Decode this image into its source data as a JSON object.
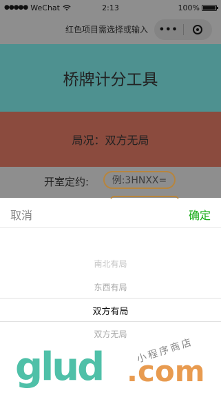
{
  "status_bar": {
    "carrier": "WeChat",
    "time": "2:13",
    "battery_percent": "100%",
    "battery_level": 1.0
  },
  "navbar": {
    "title": "红色项目需选择或输入",
    "more_glyph": "•••"
  },
  "app": {
    "title": "桥牌计分工具",
    "status": "局况：双方无局"
  },
  "contract": {
    "label": "开室定约:",
    "placeholder": "例:3HNXX="
  },
  "picker": {
    "cancel": "取消",
    "confirm": "确定",
    "options": [
      "南北有局",
      "东西有局",
      "双方有局",
      "双方无局"
    ],
    "selected": "双方有局"
  },
  "watermark": {
    "logo": "glud",
    "dotcom": ".com",
    "slogan": "小程序商店"
  },
  "colors": {
    "title_banner": "#4e9190",
    "status_banner": "#8b4b3e",
    "confirm": "#1aad19",
    "input_border": "#b7853d"
  },
  "icons": [
    "wifi-icon",
    "battery-icon",
    "more-icon",
    "close-target-icon"
  ]
}
